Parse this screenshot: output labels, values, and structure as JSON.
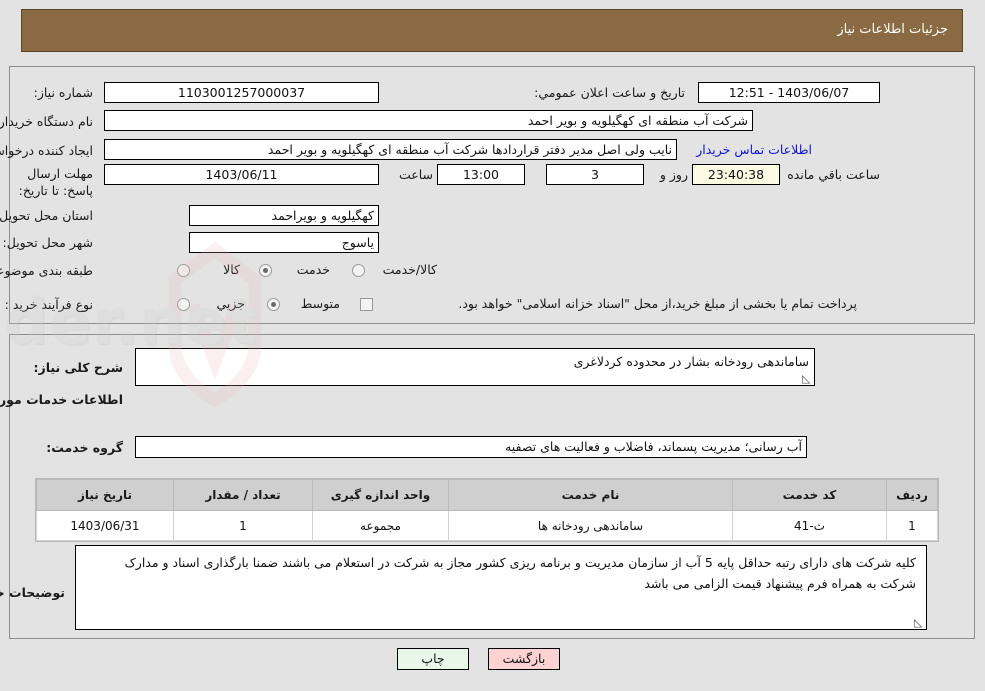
{
  "header": {
    "title": "جزئیات اطلاعات نیاز"
  },
  "form": {
    "need_number_label": "شماره نیاز:",
    "need_number_value": "1103001257000037",
    "announce_datetime_label": "تاریخ و ساعت اعلان عمومي:",
    "announce_datetime_value": "1403/06/07 - 12:51",
    "buyer_org_label": "نام دستگاه خریدار:",
    "buyer_org_value": "شرکت آب منطقه ای کهگیلویه و بویر احمد",
    "creator_label": "ایجاد کننده درخواست:",
    "creator_value": "نایب ولی اصل مدیر دفتر قراردادها شرکت آب منطقه ای کهگیلویه و بویر احمد",
    "creator_empty_value": "",
    "contact_link": "اطلاعات تماس خریدار",
    "deadline_label": "مهلت ارسال پاسخ: تا تاریخ:",
    "deadline_date": "1403/06/11",
    "hour_label": "ساعت",
    "deadline_time": "13:00",
    "days_remaining": "3",
    "days_label": "روز و",
    "countdown": "23:40:38",
    "countdown_label": "ساعت باقي مانده",
    "province_label": "استان محل تحویل:",
    "province_value": "کهگیلویه و بویراحمد",
    "city_label": "شهر محل تحویل:",
    "city_value": "یاسوج",
    "category_label": "طبقه بندی موضوعی:",
    "category_options": [
      {
        "label": "کالا",
        "selected": false
      },
      {
        "label": "خدمت",
        "selected": true
      },
      {
        "label": "کالا/خدمت",
        "selected": false
      }
    ],
    "process_label": "نوع فرآیند خرید :",
    "process_options": [
      {
        "label": "جزیي",
        "selected": false
      },
      {
        "label": "متوسط",
        "selected": true
      }
    ],
    "treasury_checkbox_label": "پرداخت تمام یا بخشی از مبلغ خرید،از محل \"اسناد خزانه اسلامی\" خواهد بود.",
    "treasury_checked": false
  },
  "summary": {
    "need_desc_label": "شرح کلی نیاز:",
    "need_desc_value": "ساماندهی رودخانه بشار در محدوده کردلاغری",
    "services_section_title": "اطلاعات خدمات مورد نیاز",
    "service_group_label": "گروه خدمت:",
    "service_group_value": "آب رسانی؛ مدیریت پسماند، فاضلاب و فعالیت های تصفیه"
  },
  "table": {
    "columns": [
      "ردیف",
      "کد خدمت",
      "نام خدمت",
      "واحد اندازه گیری",
      "تعداد / مقدار",
      "تاریخ نیاز"
    ],
    "rows": [
      [
        "1",
        "ث-41",
        "ساماندهی رودخانه ها",
        "مجموعه",
        "1",
        "1403/06/31"
      ]
    ]
  },
  "notes": {
    "label": "توضیحات خریدار:",
    "value": "کلیه شرکت های دارای  رتبه حداقل پایه 5 آب از سازمان مدیریت و برنامه ریزی کشور مجاز به شرکت در استعلام می باشند ضمنا بارگذاری اسناد و مدارک شرکت به همراه فرم پیشنهاد قیمت الزامی می باشد"
  },
  "footer": {
    "print_label": "چاپ",
    "back_label": "بازگشت"
  },
  "colors": {
    "header_bg": "#8a6a42",
    "page_bg": "#e3e3e3",
    "link": "#1414cf",
    "print_btn": "#e8f7e8",
    "back_btn": "#fdd2d2",
    "table_header": "#cfcfcf",
    "countdown_bg": "#fbfbe3"
  }
}
